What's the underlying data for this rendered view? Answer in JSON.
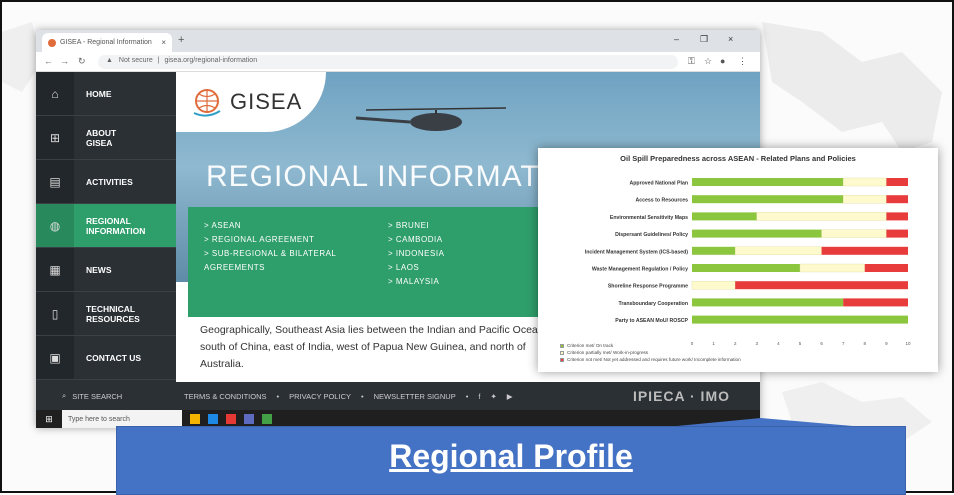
{
  "browser": {
    "tab_title": "GISEA - Regional Information",
    "new_tab": "+",
    "url_prefix": "Not secure",
    "url": "gisea.org/regional-information",
    "win_min": "–",
    "win_max": "❐",
    "win_close": "×"
  },
  "site": {
    "logo_text": "GISEA",
    "hero_title": "REGIONAL INFORMATION",
    "nav": [
      {
        "label": "HOME",
        "icon": "home-icon"
      },
      {
        "label": "ABOUT\nGISEA",
        "icon": "org-chart-icon"
      },
      {
        "label": "ACTIVITIES",
        "icon": "calendar-icon"
      },
      {
        "label": "REGIONAL\nINFORMATION",
        "icon": "globe-icon"
      },
      {
        "label": "NEWS",
        "icon": "news-icon"
      },
      {
        "label": "TECHNICAL\nRESOURCES",
        "icon": "document-icon"
      },
      {
        "label": "CONTACT US",
        "icon": "contact-icon"
      }
    ],
    "menu_left": [
      "ASEAN",
      "REGIONAL AGREEMENT",
      "SUB-REGIONAL & BILATERAL AGREEMENTS"
    ],
    "menu_right": [
      "BRUNEI",
      "CAMBODIA",
      "INDONESIA",
      "LAOS",
      "MALAYSIA"
    ],
    "description": "Geographically, Southeast Asia lies between the Indian and Pacific Oceans - south of China, east of India, west of Papua New Guinea, and north of Australia.",
    "footer": {
      "search": "SITE SEARCH",
      "links": [
        "TERMS & CONDITIONS",
        "PRIVACY POLICY",
        "NEWSLETTER SIGNUP"
      ],
      "logos": "IPIECA · IMO"
    },
    "taskbar_search": "Type here to search"
  },
  "chart_data": {
    "type": "bar",
    "title": "Oil Spill Preparedness across ASEAN - Related Plans and Policies",
    "categories": [
      "Approved National Plan",
      "Access to Resources",
      "Environmental Sensitivity Maps",
      "Dispersant Guidelines/ Policy",
      "Incident Management System (ICS-based)",
      "Waste Management Regulation / Policy",
      "Shoreline Response Programme",
      "Transboundary Cooperation",
      "Party to ASEAN MoU/ ROSCP"
    ],
    "series": [
      {
        "name": "Criterion met/ On track",
        "color": "#8cc63f",
        "values": [
          7,
          7,
          3,
          6,
          2,
          5,
          0,
          7,
          10
        ]
      },
      {
        "name": "Criterion partially met/ Work-in-progress",
        "color": "#fffacd",
        "values": [
          2,
          2,
          6,
          3,
          4,
          3,
          2,
          0,
          0
        ]
      },
      {
        "name": "Criterion not met/ Not yet addressed and requires future work/ Incomplete information",
        "color": "#e83b3b",
        "values": [
          1,
          1,
          1,
          1,
          4,
          2,
          8,
          3,
          0
        ]
      }
    ],
    "xlim": [
      0,
      10
    ],
    "xticks": [
      "0",
      "1",
      "2",
      "3",
      "4",
      "5",
      "6",
      "7",
      "8",
      "9",
      "10"
    ],
    "stacked": true,
    "orientation": "horizontal"
  },
  "banner": {
    "text": "Regional Profile"
  }
}
